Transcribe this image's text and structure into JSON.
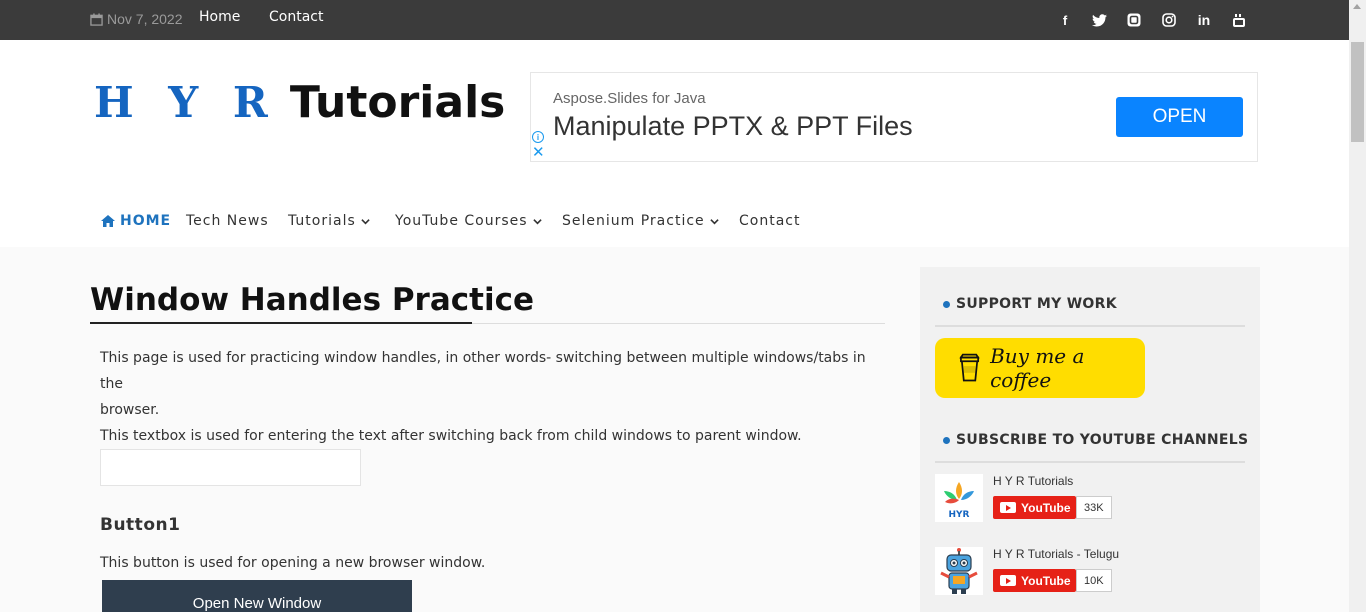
{
  "topbar": {
    "date": "Nov 7, 2022",
    "links": [
      "Home",
      "Contact"
    ],
    "social_icons": [
      "facebook-icon",
      "twitter-icon",
      "blogger-icon",
      "instagram-icon",
      "linkedin-icon",
      "youtube-icon"
    ]
  },
  "header": {
    "logo_hyr": "H Y R",
    "logo_tutorials": "Tutorials"
  },
  "ad": {
    "small_text": "Aspose.Slides for Java",
    "headline": "Manipulate PPTX & PPT Files",
    "button": "OPEN"
  },
  "nav": {
    "items": [
      {
        "label": "HOME",
        "icon": "home-icon",
        "dropdown": false
      },
      {
        "label": "Tech News",
        "dropdown": false
      },
      {
        "label": "Tutorials",
        "dropdown": true
      },
      {
        "label": "YouTube Courses",
        "dropdown": true
      },
      {
        "label": "Selenium Practice",
        "dropdown": true
      },
      {
        "label": "Contact",
        "dropdown": false
      }
    ]
  },
  "main": {
    "title": "Window Handles Practice",
    "intro_line1": "This page is used for practicing window handles, in other words- switching between multiple windows/tabs in the",
    "intro_line2": "browser.",
    "textbox_desc": "This textbox is used for entering the text after switching back from child windows to parent window.",
    "section_heading": "Button1",
    "button_desc": "This button is used for opening a new browser window.",
    "button_label": "Open New Window"
  },
  "sidebar": {
    "support_title": "SUPPORT MY WORK",
    "coffee_label": "Buy me a coffee",
    "subscribe_title": "SUBSCRIBE TO YOUTUBE CHANNELS",
    "channels": [
      {
        "name": "H Y R Tutorials",
        "button": "YouTube",
        "count": "33K",
        "thumb_text": "HYR"
      },
      {
        "name": "H Y R Tutorials - Telugu",
        "button": "YouTube",
        "count": "10K"
      }
    ]
  },
  "colors": {
    "accent": "#1e73be",
    "topbar": "#3b3b3b",
    "ad_button": "#0a84ff",
    "coffee": "#ffdd00",
    "youtube_red": "#e62117",
    "dark_button": "#2f3e4e"
  }
}
